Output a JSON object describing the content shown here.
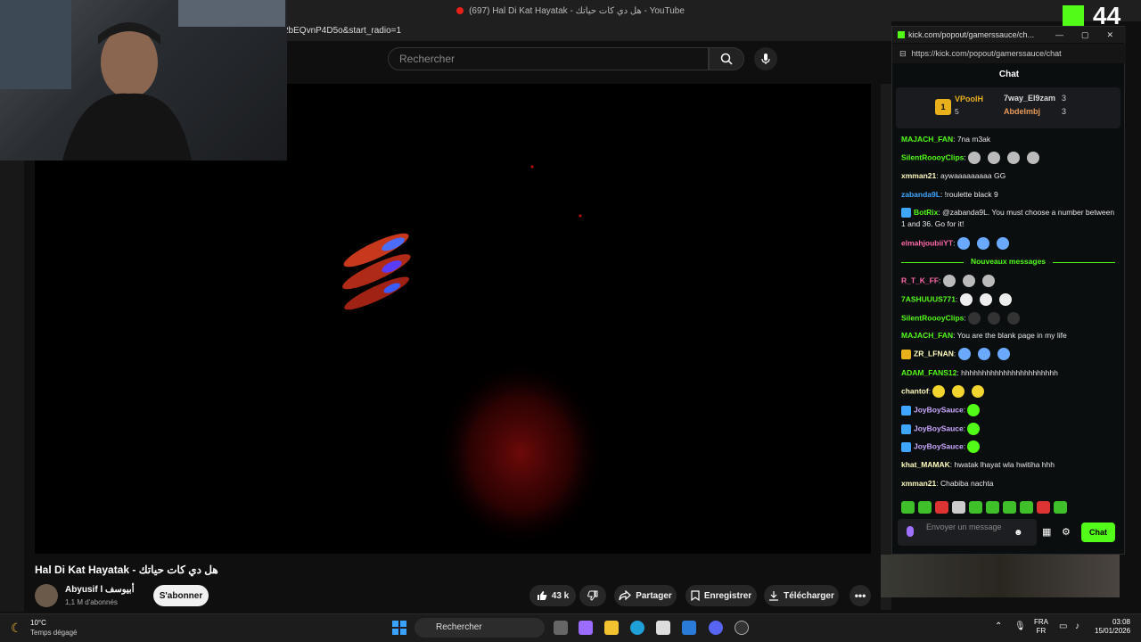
{
  "browser": {
    "tab_title": "(697) Hal Di Kat Hayatak - هل دي كات حياتك - YouTube",
    "url_fragment": "2bEQvnP4D5o&start_radio=1"
  },
  "youtube": {
    "search_placeholder": "Rechercher",
    "video_title": "Hal Di Kat Hayatak - هل دي كات حياتك",
    "channel_name": "Abyusif l أبيوسف",
    "channel_subs": "1,1 M d'abonnés",
    "subscribe_label": "S'abonner",
    "like_count": "43 k",
    "share_label": "Partager",
    "save_label": "Enregistrer",
    "download_label": "Télécharger"
  },
  "kick": {
    "window_title": "kick.com/popout/gamerssauce/ch...",
    "url": "https://kick.com/popout/gamerssauce/chat",
    "chat_heading": "Chat",
    "leaderboard": {
      "first": {
        "name": "VPoolH",
        "rank": "1",
        "count": "5"
      },
      "second": {
        "name": "7way_El9zam",
        "count": "3"
      },
      "third": {
        "name": "Abdelmbj",
        "count": "3"
      }
    },
    "messages": [
      {
        "user": "MAJACH_FAN",
        "text": "7na m3ak",
        "color": "#53fc18"
      },
      {
        "user": "SilentRoooyClips",
        "text": "",
        "color": "#53fc18"
      },
      {
        "user": "xmman21",
        "text": "aywaaaaaaaaa  GG",
        "color": "#fffcbf"
      },
      {
        "user": "zabanda9L",
        "text": "!roulette black 9",
        "color": "#3ea6ff"
      },
      {
        "user": "BotRix",
        "text": "@zabanda9L. You must choose a number between 1 and 36. Go for it!",
        "color": "#53fc18"
      },
      {
        "user": "elmahjoubiiYT",
        "text": "",
        "color": "#ff6aa9"
      },
      {
        "user": "R_T_K_FF",
        "text": "",
        "color": "#ff6aa9"
      },
      {
        "user": "7ASHUUUS771",
        "text": "",
        "color": "#53fc18"
      },
      {
        "user": "SilentRoooyClips",
        "text": "",
        "color": "#53fc18"
      },
      {
        "user": "MAJACH_FAN",
        "text": "You are the blank page in my life",
        "color": "#53fc18"
      },
      {
        "user": "ZR_LFNAN",
        "text": "",
        "color": "#fffcbf"
      },
      {
        "user": "ADAM_FANS12",
        "text": "hhhhhhhhhhhhhhhhhhhhhhh",
        "color": "#53fc18"
      },
      {
        "user": "chantof",
        "text": "",
        "color": "#fffcbf"
      },
      {
        "user": "JoyBoySauce",
        "text": "",
        "color": "#c9a8ff"
      },
      {
        "user": "JoyBoySauce",
        "text": "",
        "color": "#c9a8ff"
      },
      {
        "user": "JoyBoySauce",
        "text": "",
        "color": "#c9a8ff"
      },
      {
        "user": "khat_MAMAK",
        "text": "hwatak lhayat wla hwitiha hhh",
        "color": "#fffcbf"
      },
      {
        "user": "xmman21",
        "text": "Chabiba nachta",
        "color": "#fffcbf"
      }
    ],
    "new_messages_label": "Nouveaux messages",
    "input_placeholder": "Envoyer un message",
    "send_label": "Chat"
  },
  "overlay": {
    "viewer_count": "44"
  },
  "taskbar": {
    "temperature": "10°C",
    "weather": "Temps dégagé",
    "search_label": "Rechercher",
    "lang_top": "FRA",
    "lang_bottom": "FR",
    "time": "03:08",
    "date": "15/01/2026"
  }
}
